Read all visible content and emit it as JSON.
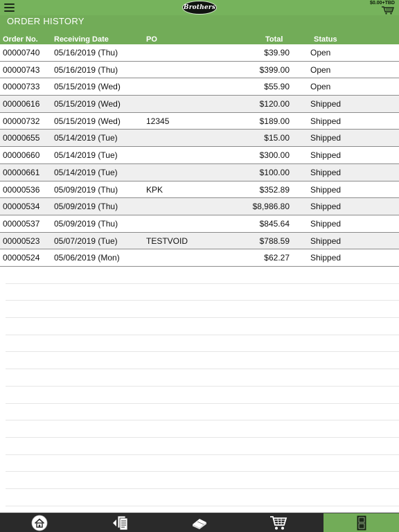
{
  "header": {
    "cart_total": "$0.00+TBD",
    "logo_text": "Brothers",
    "menu_icon": "hamburger-icon",
    "cart_icon": "shopping-cart-icon"
  },
  "page": {
    "title": "ORDER HISTORY"
  },
  "table": {
    "columns": {
      "order_no": "Order No.",
      "receiving_date": "Receiving Date",
      "po": "PO",
      "total": "Total",
      "status": "Status"
    },
    "rows": [
      {
        "order_no": "00000740",
        "receiving_date": "05/16/2019 (Thu)",
        "po": "",
        "total": "$39.90",
        "status": "Open"
      },
      {
        "order_no": "00000743",
        "receiving_date": "05/16/2019 (Thu)",
        "po": "",
        "total": "$399.00",
        "status": "Open"
      },
      {
        "order_no": "00000733",
        "receiving_date": "05/15/2019 (Wed)",
        "po": "",
        "total": "$55.90",
        "status": "Open"
      },
      {
        "order_no": "00000616",
        "receiving_date": "05/15/2019 (Wed)",
        "po": "",
        "total": "$120.00",
        "status": "Shipped"
      },
      {
        "order_no": "00000732",
        "receiving_date": "05/15/2019 (Wed)",
        "po": "12345",
        "total": "$189.00",
        "status": "Shipped"
      },
      {
        "order_no": "00000655",
        "receiving_date": "05/14/2019 (Tue)",
        "po": "",
        "total": "$15.00",
        "status": "Shipped"
      },
      {
        "order_no": "00000660",
        "receiving_date": "05/14/2019 (Tue)",
        "po": "",
        "total": "$300.00",
        "status": "Shipped"
      },
      {
        "order_no": "00000661",
        "receiving_date": "05/14/2019 (Tue)",
        "po": "",
        "total": "$100.00",
        "status": "Shipped"
      },
      {
        "order_no": "00000536",
        "receiving_date": "05/09/2019 (Thu)",
        "po": "KPK",
        "total": "$352.89",
        "status": "Shipped"
      },
      {
        "order_no": "00000534",
        "receiving_date": "05/09/2019 (Thu)",
        "po": "",
        "total": "$8,986.80",
        "status": "Shipped"
      },
      {
        "order_no": "00000537",
        "receiving_date": "05/09/2019 (Thu)",
        "po": "",
        "total": "$845.64",
        "status": "Shipped"
      },
      {
        "order_no": "00000523",
        "receiving_date": "05/07/2019 (Tue)",
        "po": "TESTVOID",
        "total": "$788.59",
        "status": "Shipped"
      },
      {
        "order_no": "00000524",
        "receiving_date": "05/06/2019 (Mon)",
        "po": "",
        "total": "$62.27",
        "status": "Shipped"
      }
    ]
  },
  "tabbar": {
    "tabs": [
      {
        "icon": "home-icon",
        "active": false
      },
      {
        "icon": "order-documents-icon",
        "active": false
      },
      {
        "icon": "catalog-book-icon",
        "active": false
      },
      {
        "icon": "shopping-cart-icon",
        "active": false
      },
      {
        "icon": "account-device-icon",
        "active": true
      }
    ]
  },
  "colors": {
    "brand_green": "#72ac58",
    "header_green": "#76b35c",
    "footer_dark": "#2a2a2a",
    "row_alt": "#efefef"
  }
}
